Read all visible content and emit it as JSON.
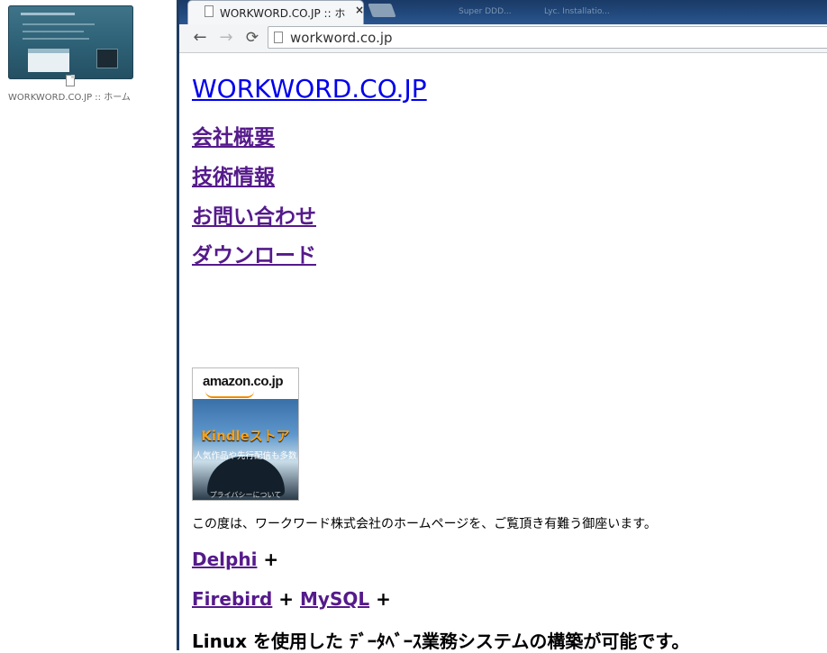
{
  "desktop": {
    "thumbnail_label": "WORKWORD.CO.JP :: ホーム"
  },
  "browser": {
    "tab_title": "WORKWORD.CO.JP :: ホ",
    "tab_close": "×",
    "ghost_tabs": [
      "Super DDD...",
      "Lyc. Installatio..."
    ],
    "url": "workword.co.jp",
    "back_icon": "←",
    "forward_icon": "→",
    "reload_icon": "⟳"
  },
  "page": {
    "site_title": "WORKWORD.CO.JP",
    "nav": [
      "会社概要",
      "技術情報",
      "お問い合わせ",
      "ダウンロード"
    ],
    "banner": {
      "logo": "amazon.co.jp",
      "store": "Kindleストア",
      "sub": "人気作品や先行配信も多数",
      "privacy": "プライバシーについて"
    },
    "welcome": "この度は、ワークワード株式会社のホームページを、ご覧頂き有難う御座います。",
    "tech": {
      "delphi": "Delphi",
      "firebird": "Firebird",
      "mysql": "MySQL",
      "plus": "+",
      "linux": "Linux",
      "closing": "を使用した ﾃﾞｰﾀﾍﾞｰｽ業務システムの構築が可能です。"
    }
  }
}
